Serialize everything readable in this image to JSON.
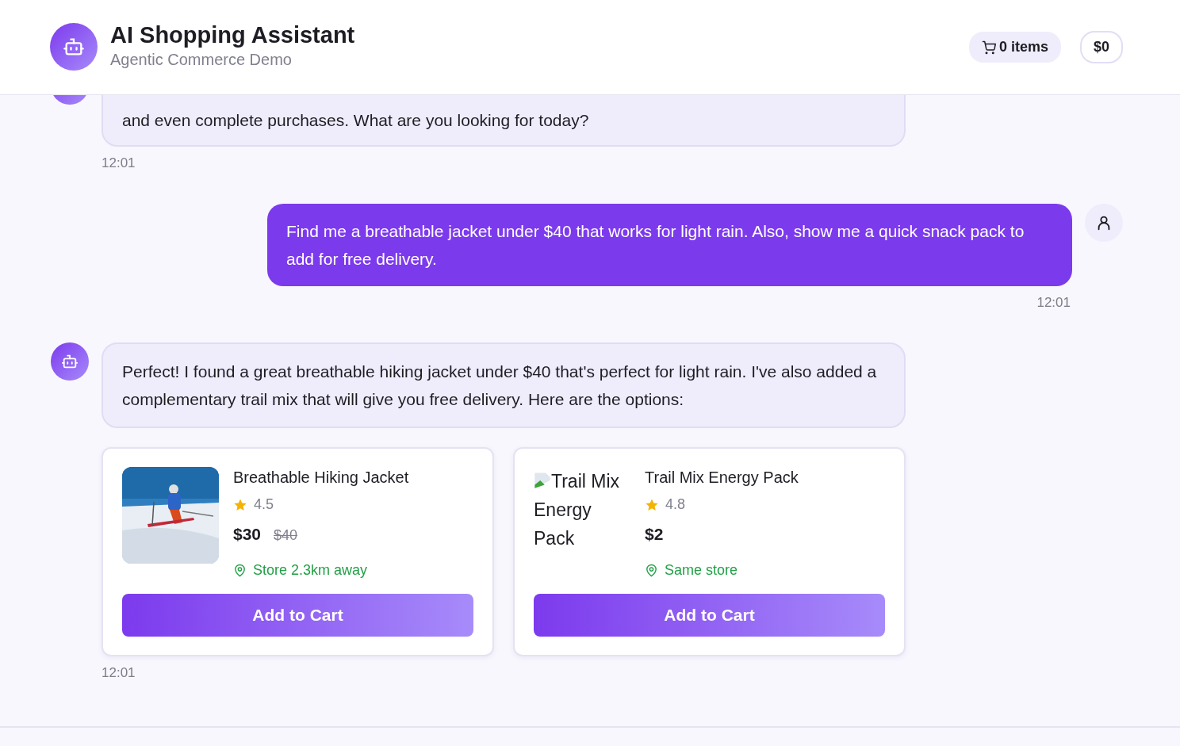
{
  "header": {
    "title": "AI Shopping Assistant",
    "subtitle": "Agentic Commerce Demo",
    "cart_count": "0 items",
    "cart_total": "$0"
  },
  "messages": [
    {
      "kind": "assistant",
      "text": "and even complete purchases. What are you looking for today?",
      "time": "12:01"
    },
    {
      "kind": "user",
      "text": "Find me a breathable jacket under $40 that works for light rain. Also, show me a quick snack pack to add for free delivery.",
      "time": "12:01"
    },
    {
      "kind": "assistant",
      "text": "Perfect! I found a great breathable hiking jacket under $40 that's perfect for light rain. I've also added a complementary trail mix that will give you free delivery. Here are the options:",
      "time": "12:01",
      "products": [
        {
          "name": "Breathable Hiking Jacket",
          "rating": "4.5",
          "price": "$30",
          "old_price": "$40",
          "location": "Store 2.3km away",
          "button": "Add to Cart"
        },
        {
          "name": "Trail Mix Energy Pack",
          "image": {
            "kind": "broken",
            "alt": "Trail Mix Energy Pack"
          },
          "rating": "4.8",
          "price": "$2",
          "location": "Same store",
          "button": "Add to Cart"
        }
      ]
    }
  ]
}
